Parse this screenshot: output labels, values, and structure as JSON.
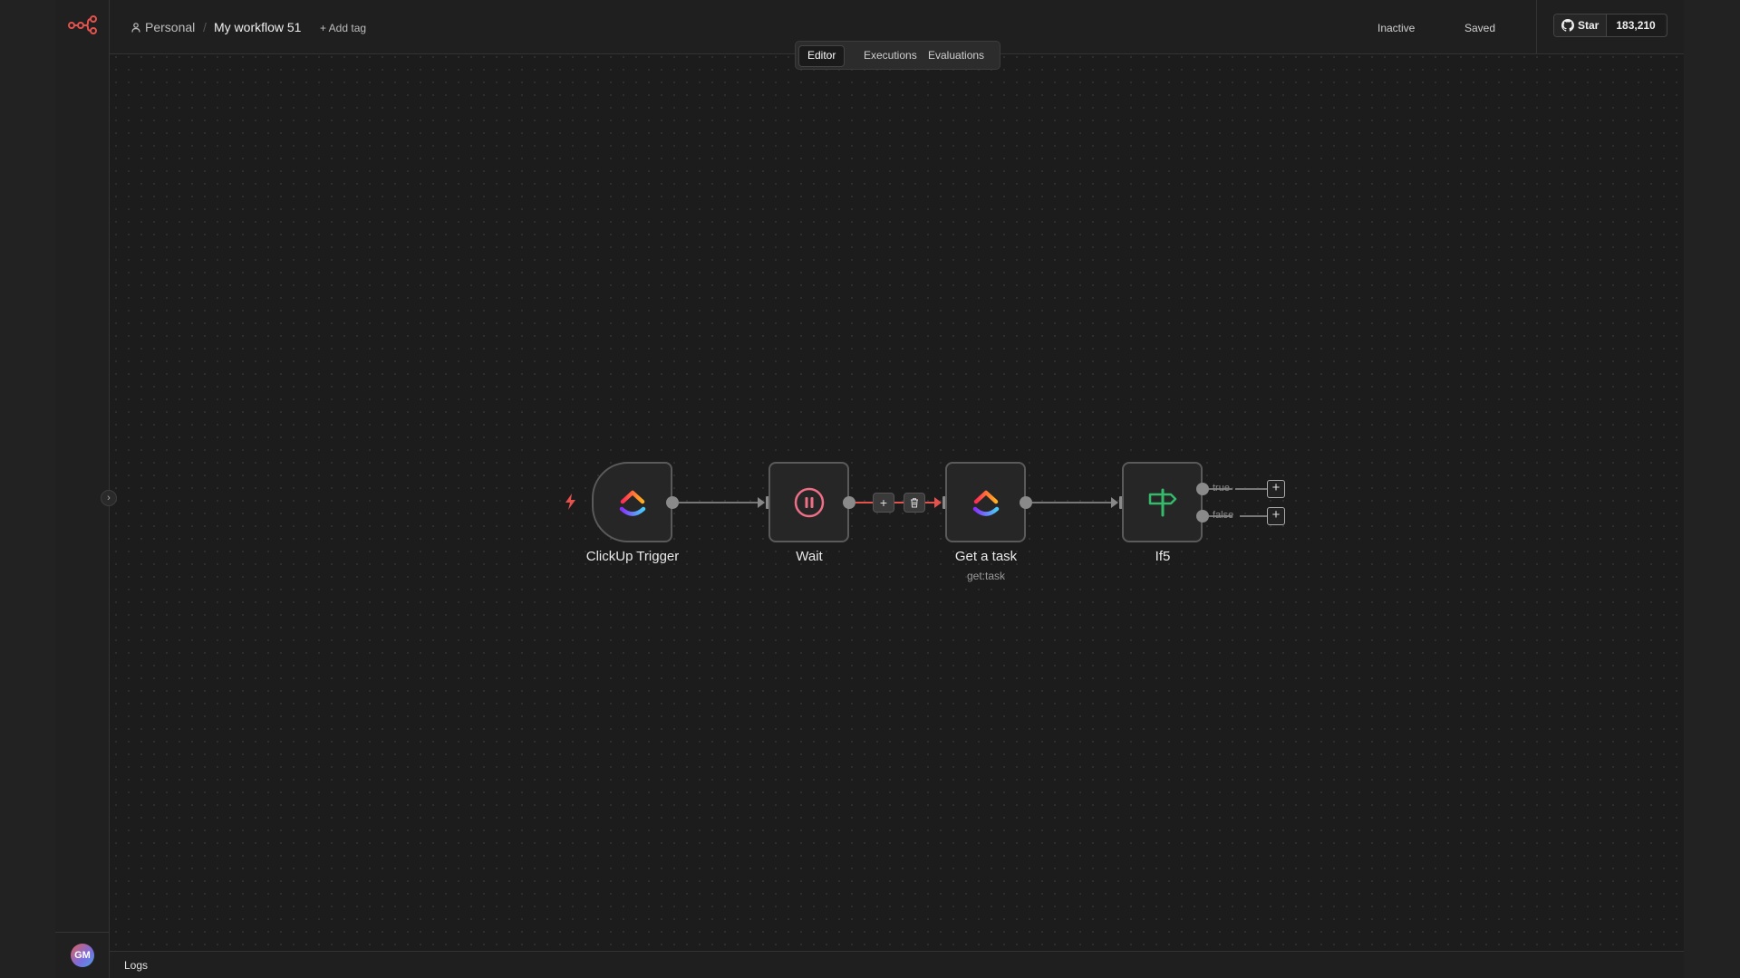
{
  "header": {
    "breadcrumb_project": "Personal",
    "breadcrumb_separator": "/",
    "workflow_name": "My workflow 51",
    "add_tag_label": "+ Add tag",
    "active_status": "Inactive",
    "save_status": "Saved",
    "github_star_label": "Star",
    "github_star_count": "183,210"
  },
  "tabs": [
    {
      "label": "Editor",
      "active": true
    },
    {
      "label": "Executions",
      "active": false
    },
    {
      "label": "Evaluations",
      "active": false
    }
  ],
  "nodes": [
    {
      "name": "ClickUp Trigger",
      "subtitle": "",
      "icon": "clickup-icon"
    },
    {
      "name": "Wait",
      "subtitle": "",
      "icon": "pause-icon"
    },
    {
      "name": "Get a task",
      "subtitle": "get:task",
      "icon": "clickup-icon"
    },
    {
      "name": "If5",
      "subtitle": "",
      "icon": "signpost-icon"
    }
  ],
  "branches": {
    "true_label": "true",
    "false_label": "false"
  },
  "edge_controls": {
    "add_label": "+"
  },
  "user": {
    "initials": "GM"
  },
  "footer": {
    "logs_label": "Logs"
  },
  "colors": {
    "accent": "#e4524d",
    "wait_icon": "#ef6f87",
    "if_icon": "#35b96a",
    "canvas_bg": "#1c1c1c"
  }
}
